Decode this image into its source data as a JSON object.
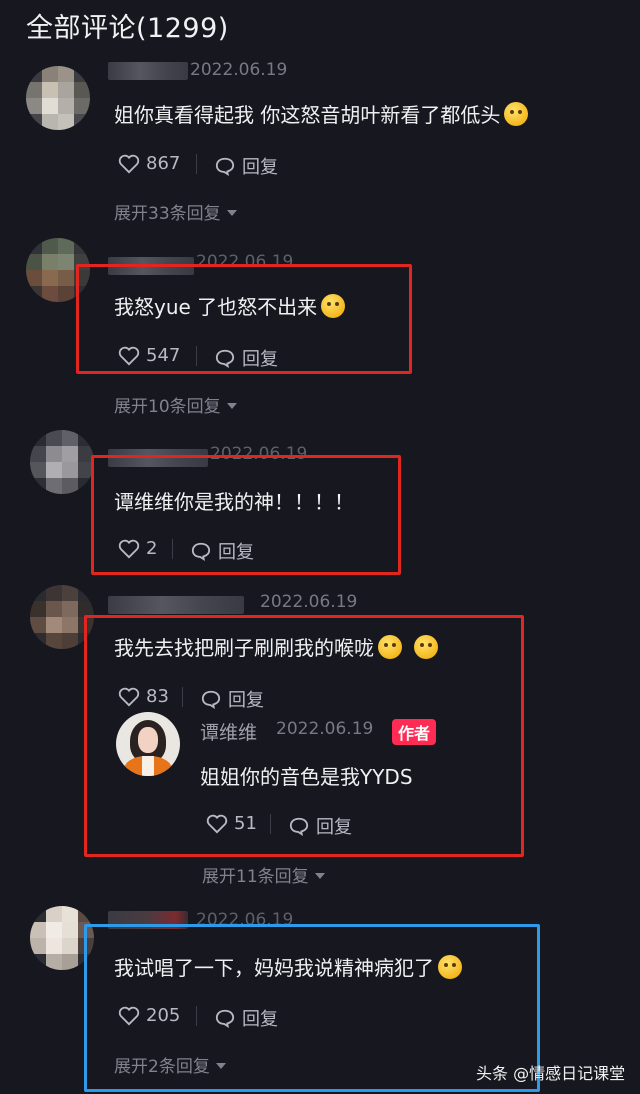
{
  "header": {
    "title": "全部评论(1299)"
  },
  "reply_label": "回复",
  "comments": [
    {
      "date": "2022.06.19",
      "text": "姐你真看得起我 你这怒音胡叶新看了都低头",
      "emoji": "crying-face-icon",
      "likes": "867",
      "expand": "展开33条回复"
    },
    {
      "date": "2022.06.19",
      "text": "我怒yue 了也怒不出来",
      "emoji": "pleading-face-icon",
      "likes": "547",
      "expand": "展开10条回复"
    },
    {
      "date": "2022.06.19",
      "text": "谭维维你是我的神！！！！",
      "likes": "2"
    },
    {
      "date": "2022.06.19",
      "text": "我先去找把刷子刷刷我的喉咙",
      "emoji": "rofl-face-icon",
      "likes": "83",
      "reply": {
        "name": "谭维维",
        "date": "2022.06.19",
        "badge": "作者",
        "text": "姐姐你的音色是我YYDS",
        "likes": "51"
      },
      "expand": "展开11条回复"
    },
    {
      "date": "2022.06.19",
      "text": "我试唱了一下，妈妈我说精神病犯了",
      "emoji": "grinning-face-icon",
      "likes": "205",
      "expand": "展开2条回复"
    }
  ],
  "watermark": "头条 @情感日记课堂",
  "colors": {
    "background": "#16171f",
    "highlight_red": "#e0261f",
    "highlight_blue": "#2e9bea",
    "author_badge": "#fe2c55"
  }
}
